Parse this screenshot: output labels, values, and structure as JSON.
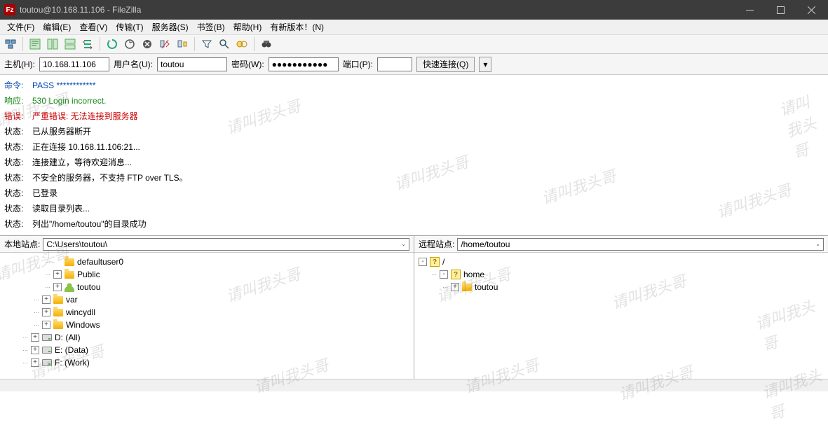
{
  "window": {
    "title": "toutou@10.168.11.106 - FileZilla",
    "app_icon_text": "Fz"
  },
  "menu": [
    "文件(F)",
    "编辑(E)",
    "查看(V)",
    "传输(T)",
    "服务器(S)",
    "书签(B)",
    "帮助(H)",
    "有新版本！(N)"
  ],
  "quickconnect": {
    "host_label": "主机(H):",
    "host_value": "10.168.11.106",
    "user_label": "用户名(U):",
    "user_value": "toutou",
    "pass_label": "密码(W):",
    "pass_value": "●●●●●●●●●●●",
    "port_label": "端口(P):",
    "port_value": "",
    "connect_label": "快速连接(Q)",
    "drop_glyph": "▾"
  },
  "log": [
    {
      "cls": "log-cmd",
      "tag": "命令:",
      "msg": "PASS ************"
    },
    {
      "cls": "log-resp",
      "tag": "响应:",
      "msg": "530 Login incorrect."
    },
    {
      "cls": "log-err",
      "tag": "错误:",
      "msg": "严重错误: 无法连接到服务器"
    },
    {
      "cls": "log-stat",
      "tag": "状态:",
      "msg": "已从服务器断开"
    },
    {
      "cls": "log-stat",
      "tag": "状态:",
      "msg": "正在连接 10.168.11.106:21..."
    },
    {
      "cls": "log-stat",
      "tag": "状态:",
      "msg": "连接建立，等待欢迎消息..."
    },
    {
      "cls": "log-stat",
      "tag": "状态:",
      "msg": "不安全的服务器，不支持 FTP over TLS。"
    },
    {
      "cls": "log-stat",
      "tag": "状态:",
      "msg": "已登录"
    },
    {
      "cls": "log-stat",
      "tag": "状态:",
      "msg": "读取目录列表..."
    },
    {
      "cls": "log-stat",
      "tag": "状态:",
      "msg": "列出\"/home/toutou\"的目录成功"
    }
  ],
  "local": {
    "label": "本地站点:",
    "path": "C:\\Users\\toutou\\",
    "tree": [
      {
        "indent": 60,
        "exp": "",
        "icon": "folder",
        "label": "defaultuser0"
      },
      {
        "indent": 60,
        "exp": "+",
        "icon": "folder",
        "label": "Public"
      },
      {
        "indent": 60,
        "exp": "+",
        "icon": "user",
        "label": "toutou"
      },
      {
        "indent": 44,
        "exp": "+",
        "icon": "folder",
        "label": "var"
      },
      {
        "indent": 44,
        "exp": "+",
        "icon": "folder",
        "label": "wincydll"
      },
      {
        "indent": 44,
        "exp": "+",
        "icon": "folder",
        "label": "Windows"
      },
      {
        "indent": 28,
        "exp": "+",
        "icon": "drive",
        "label": "D: (All)"
      },
      {
        "indent": 28,
        "exp": "+",
        "icon": "drive",
        "label": "E: (Data)"
      },
      {
        "indent": 28,
        "exp": "+",
        "icon": "drive",
        "label": "F: (Work)"
      }
    ]
  },
  "remote": {
    "label": "远程站点:",
    "path": "/home/toutou",
    "tree": [
      {
        "indent": 4,
        "exp": "-",
        "icon": "q",
        "label": "/"
      },
      {
        "indent": 20,
        "exp": "-",
        "icon": "q",
        "label": "home"
      },
      {
        "indent": 36,
        "exp": "+",
        "icon": "folder",
        "label": "toutou"
      }
    ]
  },
  "watermark_text": "请叫我头哥"
}
